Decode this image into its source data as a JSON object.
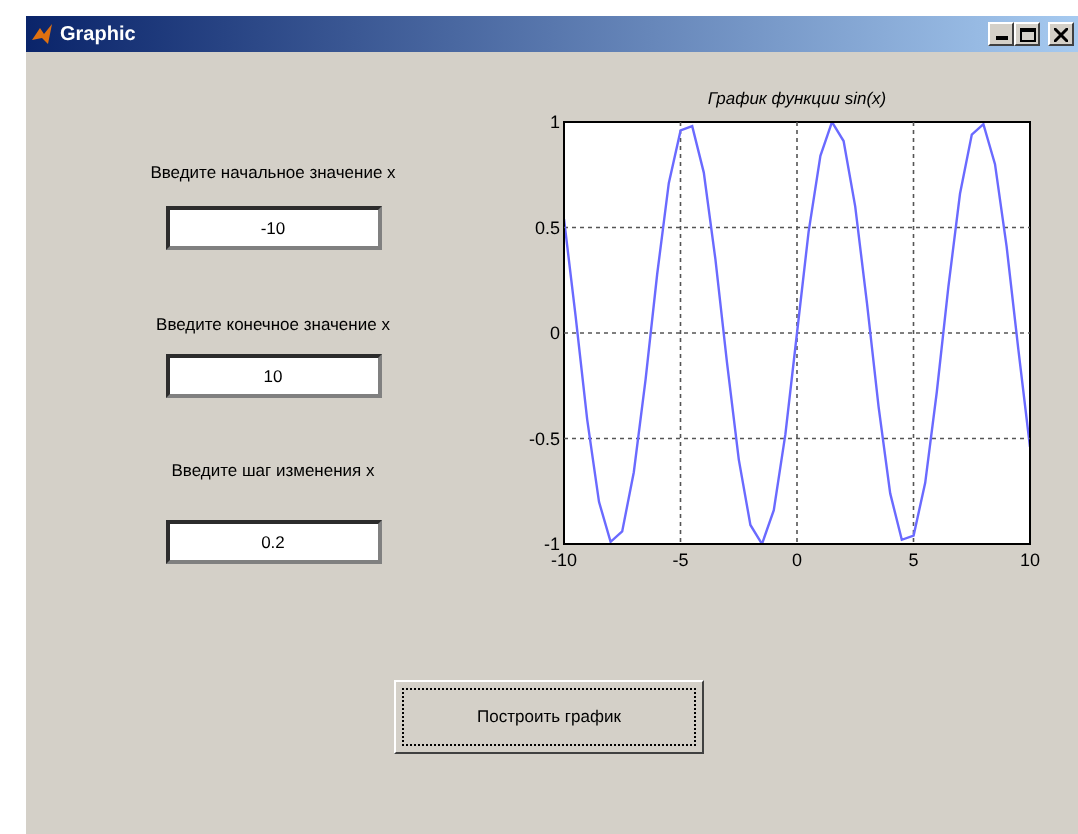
{
  "window": {
    "title": "Graphic"
  },
  "inputs": [
    {
      "label": "Введите начальное значение x",
      "value": "-10"
    },
    {
      "label": "Введите конечное значение x",
      "value": "10"
    },
    {
      "label": "Введите шаг изменения x",
      "value": "0.2"
    }
  ],
  "plot": {
    "chart_data": {
      "type": "line",
      "title": "График функции sin(x)",
      "xlim": [
        -10,
        10
      ],
      "ylim": [
        -1,
        1
      ],
      "xticks": [
        -10,
        -5,
        0,
        5,
        10
      ],
      "yticks": [
        -1,
        -0.5,
        0,
        0.5,
        1
      ],
      "grid": true,
      "x": [
        -10,
        -9.5,
        -9,
        -8.5,
        -8,
        -7.5,
        -7,
        -6.5,
        -6,
        -5.5,
        -5,
        -4.5,
        -4,
        -3.5,
        -3,
        -2.5,
        -2,
        -1.5,
        -1,
        -0.5,
        0,
        0.5,
        1,
        1.5,
        2,
        2.5,
        3,
        3.5,
        4,
        4.5,
        5,
        5.5,
        6,
        6.5,
        7,
        7.5,
        8,
        8.5,
        9,
        9.5,
        10
      ],
      "series": [
        {
          "color": "#6a6aff",
          "values": [
            0.54,
            0.08,
            -0.41,
            -0.8,
            -0.99,
            -0.94,
            -0.66,
            -0.22,
            0.28,
            0.71,
            0.96,
            0.98,
            0.76,
            0.35,
            -0.14,
            -0.6,
            -0.91,
            -1,
            -0.84,
            -0.48,
            0,
            0.48,
            0.84,
            1,
            0.91,
            0.6,
            0.14,
            -0.35,
            -0.76,
            -0.98,
            -0.96,
            -0.71,
            -0.28,
            0.22,
            0.66,
            0.94,
            0.99,
            0.8,
            0.41,
            -0.08,
            -0.54
          ]
        }
      ]
    }
  },
  "button": {
    "label": "Построить график"
  }
}
